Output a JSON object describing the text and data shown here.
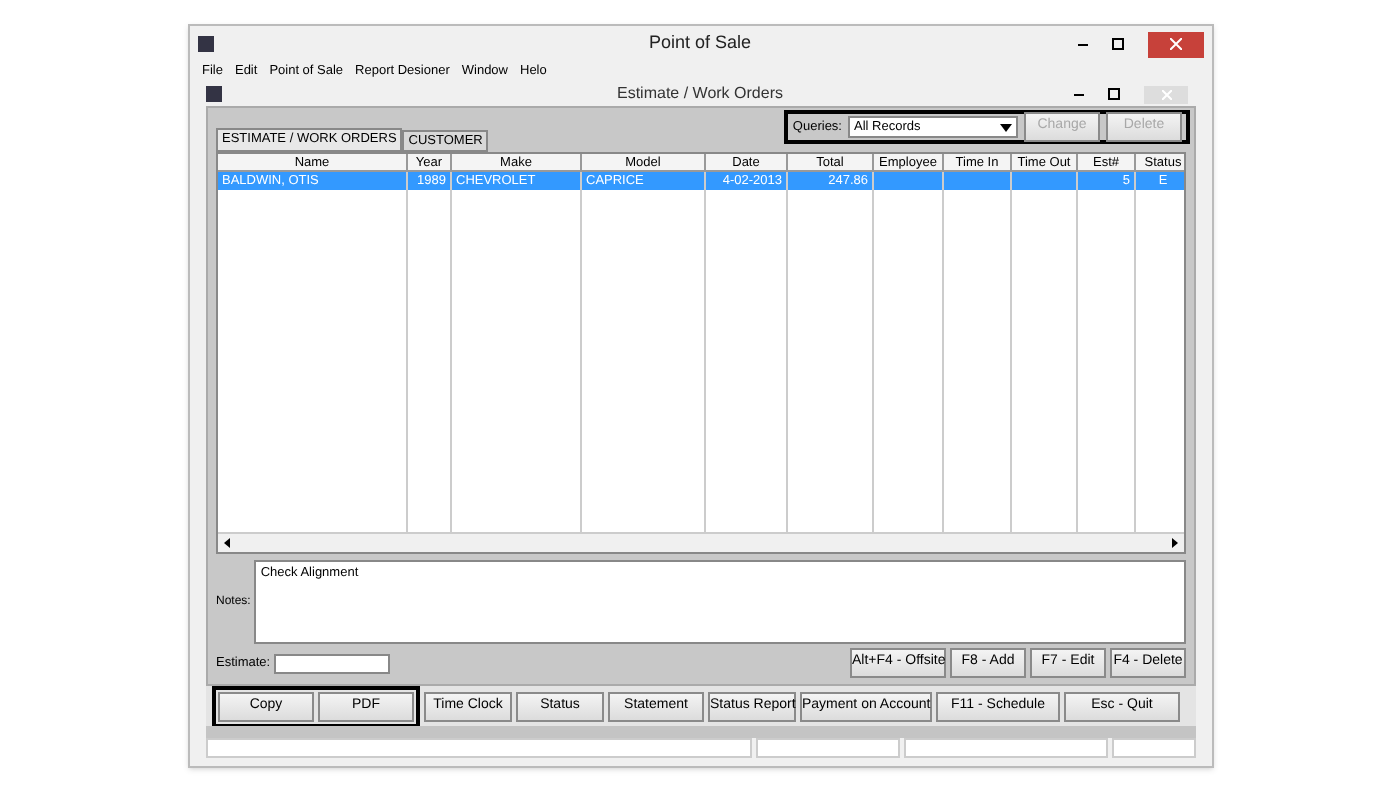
{
  "app_window": {
    "title": "Point of Sale"
  },
  "menu": [
    "File",
    "Edit",
    "Point of Sale",
    "Report Desioner",
    "Window",
    "Helo"
  ],
  "child_window": {
    "title": "Estimate / Work Orders"
  },
  "tabs": [
    {
      "label": "ESTIMATE / WORK ORDERS",
      "selected": true
    },
    {
      "label": "CUSTOMER",
      "selected": false
    }
  ],
  "queries": {
    "label": "Queries:",
    "value": "All Records"
  },
  "query_buttons": [
    {
      "label": "Change",
      "disabled": true
    },
    {
      "label": "Delete",
      "disabled": true
    }
  ],
  "table": {
    "columns": [
      "Name",
      "Year",
      "Make",
      "Model",
      "Date",
      "Total",
      "Employee",
      "Time In",
      "Time Out",
      "Est#",
      "Status"
    ],
    "rows": [
      {
        "selected": true,
        "cells": [
          "BALDWIN, OTIS",
          "1989",
          "CHEVROLET",
          "CAPRICE",
          "4-02-2013",
          "247.86",
          "",
          "",
          "",
          "5",
          "E"
        ]
      }
    ]
  },
  "notes": {
    "label": "Notes:",
    "value": "Check Alignment"
  },
  "estimate": {
    "label": "Estimate:"
  },
  "action_buttons": [
    "Alt+F4 - Offsite",
    "F8 - Add",
    "F7 - Edit",
    "F4 - Delete"
  ],
  "bottom_buttons": [
    "Copy",
    "PDF",
    "Time Clock",
    "Status",
    "Statement",
    "Status Report",
    "Payment on Account",
    "F11 - Schedule",
    "Esc - Quit"
  ]
}
